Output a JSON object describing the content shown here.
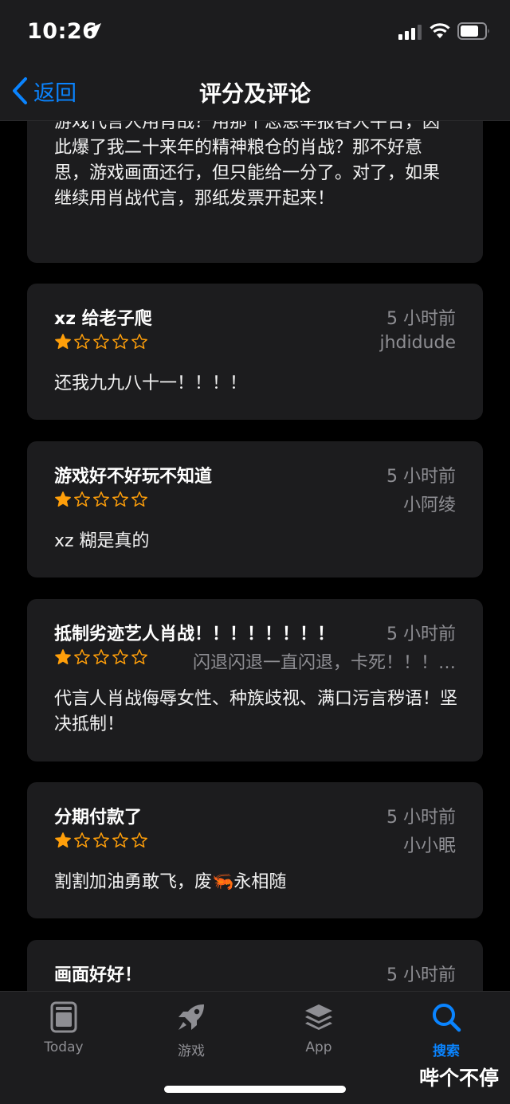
{
  "status_bar": {
    "time": "10:26"
  },
  "nav": {
    "back_label": "返回",
    "title": "评分及评论"
  },
  "reviews": [
    {
      "body": "游戏代言人用肖战？用那个恋患举报各大平台，因此爆了我二十来年的精神粮仓的肖战？那不好意思，游戏画面还行，但只能给一分了。对了，如果继续用肖战代言，那纸发票开起来！"
    },
    {
      "title": "xz 给老子爬",
      "date": "5 小时前",
      "author": "jhdidude",
      "rating": 1,
      "body": "还我九九八十一！！！！"
    },
    {
      "title": "游戏好不好玩不知道",
      "date": "5 小时前",
      "author": "小阿绫",
      "rating": 1,
      "body": "xz 糊是真的"
    },
    {
      "title": "抵制劣迹艺人肖战！！！！！！！！",
      "date": "5 小时前",
      "author": "闪退闪退一直闪退，卡死！！！…",
      "rating": 1,
      "body": "代言人肖战侮辱女性、种族歧视、满口污言秽语！坚决抵制！"
    },
    {
      "title": "分期付款了",
      "date": "5 小时前",
      "author": "小小眠",
      "rating": 1,
      "body": "割割加油勇敢飞，废🦐永相随"
    },
    {
      "title": "画面好好！",
      "date": "5 小时前",
      "author": "",
      "rating": 0,
      "body": ""
    }
  ],
  "tabs": [
    {
      "label": "Today",
      "icon": "today-icon",
      "active": false
    },
    {
      "label": "游戏",
      "icon": "rocket-icon",
      "active": false
    },
    {
      "label": "App",
      "icon": "layers-icon",
      "active": false
    },
    {
      "label": "搜索",
      "icon": "search-icon",
      "active": true
    }
  ],
  "watermark": "哔个不停",
  "colors": {
    "accent": "#0a84ff",
    "star": "#ff9f0a",
    "card": "#1c1c1e",
    "secondary_text": "#8e8e93"
  }
}
